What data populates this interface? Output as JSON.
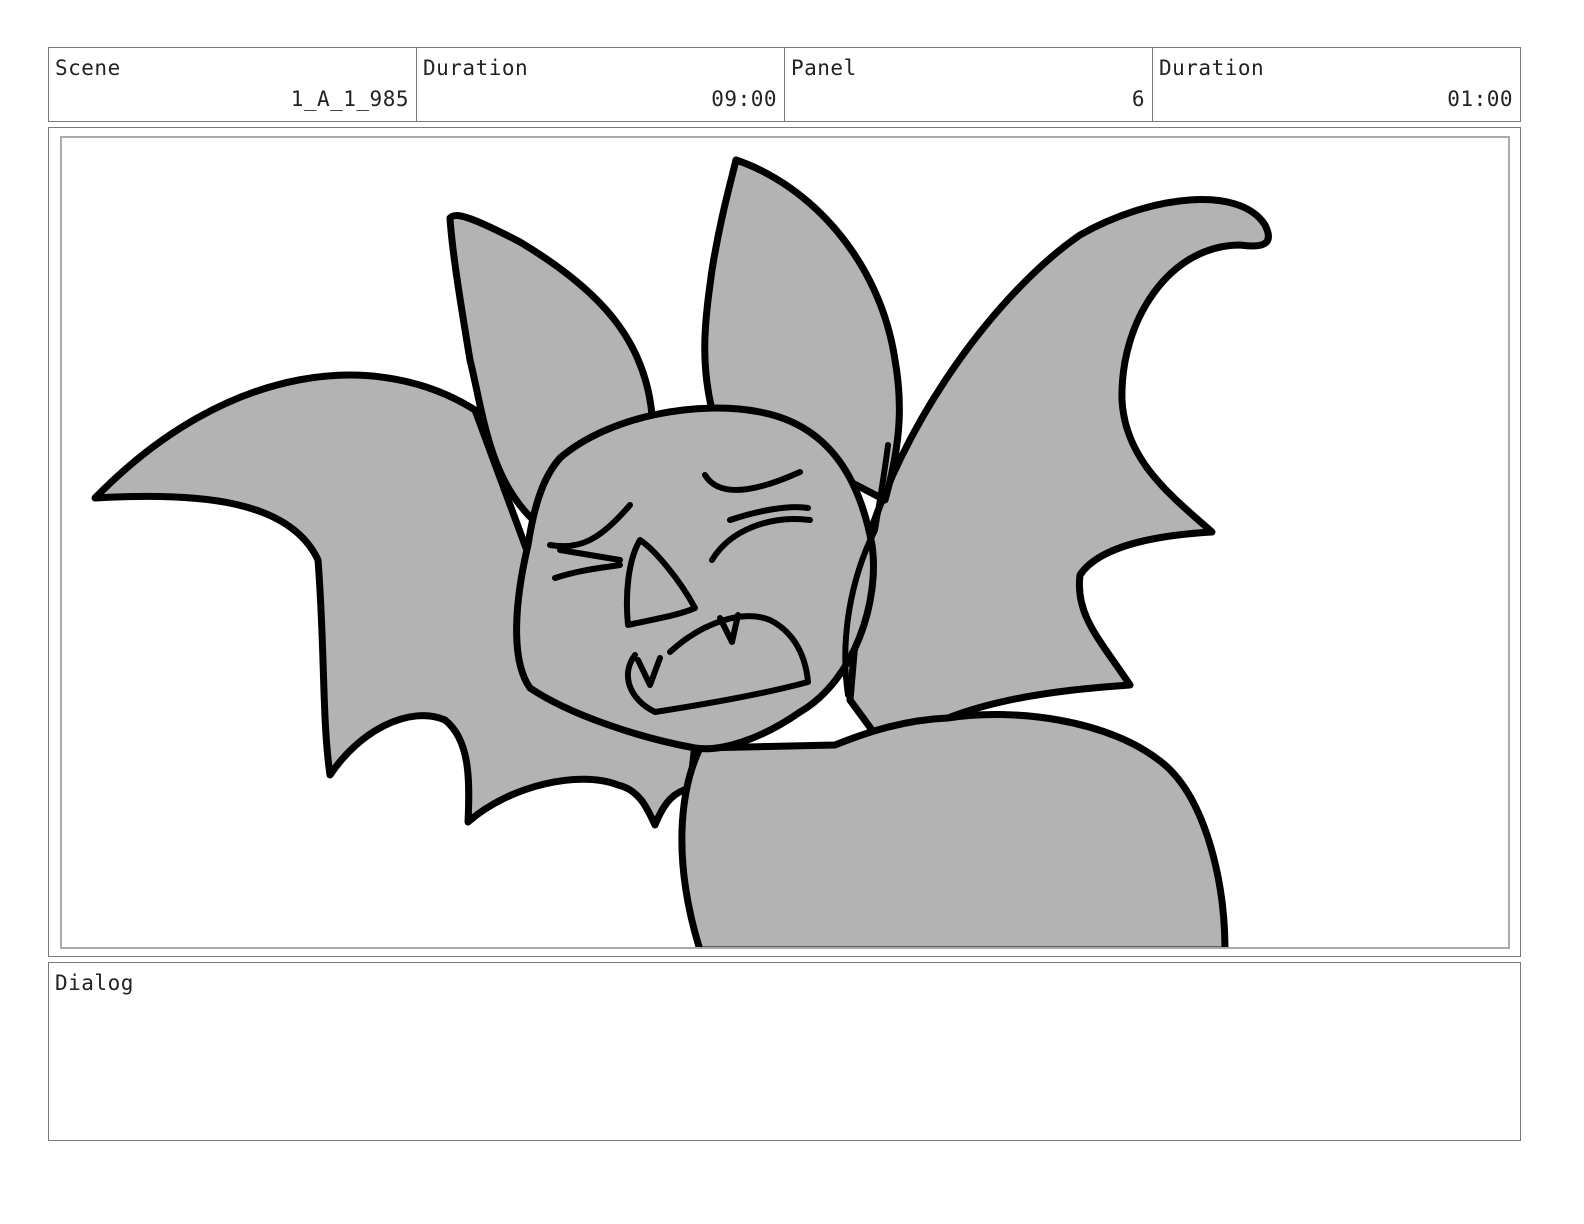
{
  "header": {
    "scene": {
      "label": "Scene",
      "value": "1_A_1_985"
    },
    "scene_duration": {
      "label": "Duration",
      "value": "09:00"
    },
    "panel": {
      "label": "Panel",
      "value": "6"
    },
    "panel_duration": {
      "label": "Duration",
      "value": "01:00"
    }
  },
  "dialog": {
    "label": "Dialog",
    "text": ""
  },
  "artwork": {
    "subject": "cartoon bat with spread wings, eyes squeezed shut",
    "fill_color": "#b3b3b3",
    "line_color": "#000000"
  }
}
